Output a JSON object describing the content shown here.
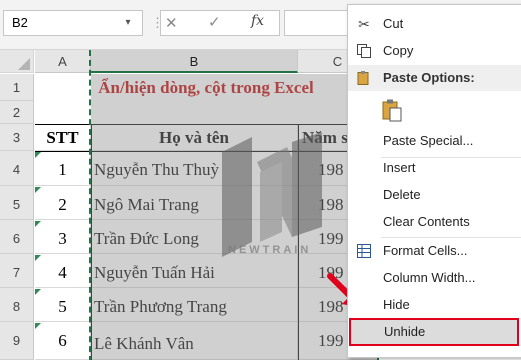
{
  "formula_bar": {
    "name_box": "B2",
    "cancel_symbol": "✕",
    "enter_symbol": "✓",
    "fx_label": "fx",
    "dots": "⋮",
    "dropdown": "▾"
  },
  "columns": [
    {
      "label": "A"
    },
    {
      "label": "B"
    },
    {
      "label": "C"
    }
  ],
  "rows": [
    "1",
    "2",
    "3",
    "4",
    "5",
    "6",
    "7",
    "8",
    "9"
  ],
  "sheet": {
    "title": "Ẩn/hiện dòng, cột trong Excel",
    "headers": {
      "stt": "STT",
      "name": "Họ và tên",
      "year": "Năm s"
    },
    "records": [
      {
        "stt": "1",
        "name": "Nguyễn Thu Thuỳ",
        "year": "198"
      },
      {
        "stt": "2",
        "name": "Ngô Mai Trang",
        "year": "198"
      },
      {
        "stt": "3",
        "name": "Trần Đức Long",
        "year": "199"
      },
      {
        "stt": "4",
        "name": "Nguyễn Tuấn Hải",
        "year": "199"
      },
      {
        "stt": "5",
        "name": "Trần Phương Trang",
        "year": "198"
      },
      {
        "stt": "6",
        "name": "Lê Khánh Vân",
        "year": "199"
      }
    ]
  },
  "watermark": {
    "text": "NEWTRAIN"
  },
  "context_menu": {
    "cut": "Cut",
    "copy": "Copy",
    "paste_options": "Paste Options:",
    "paste_special": "Paste Special...",
    "insert": "Insert",
    "delete": "Delete",
    "clear_contents": "Clear Contents",
    "format_cells": "Format Cells...",
    "column_width": "Column Width...",
    "hide": "Hide",
    "unhide": "Unhide"
  },
  "colors": {
    "accent": "#217346",
    "title": "#c00000",
    "highlight_border": "#e0001a"
  }
}
